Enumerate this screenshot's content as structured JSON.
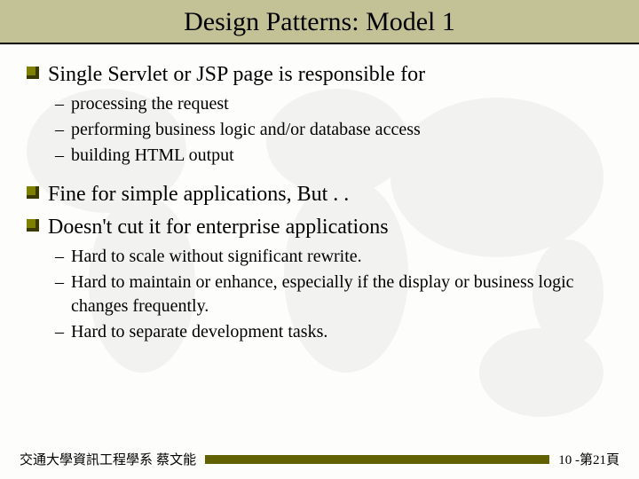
{
  "title": "Design Patterns: Model 1",
  "bullets": [
    {
      "text": "Single Servlet or JSP page is responsible for",
      "subs": [
        "processing the request",
        "performing business logic and/or database access",
        "building HTML output"
      ]
    },
    {
      "text": "Fine for simple applications, But . .",
      "subs": []
    },
    {
      "text": "Doesn't cut it for enterprise applications",
      "subs": [
        "Hard to scale without significant rewrite.",
        "Hard to maintain or enhance, especially if the display or business logic changes frequently.",
        "Hard to separate development tasks."
      ]
    }
  ],
  "footer": {
    "left": "交通大學資訊工程學系 蔡文能",
    "right": "10 -第21頁"
  }
}
